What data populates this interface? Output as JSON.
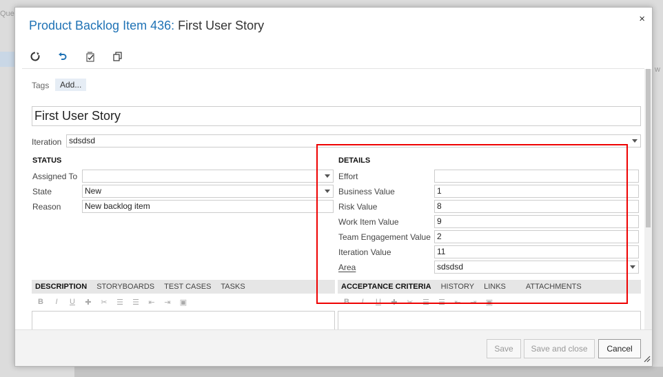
{
  "background": {
    "frag_top": "Queri",
    "frag_right": "w"
  },
  "dialog": {
    "title_link": "Product Backlog Item 436:",
    "title_text": " First User Story",
    "close": "×"
  },
  "toolbar": {
    "icons": [
      "refresh-icon",
      "undo-icon",
      "history-icon",
      "copy-icon"
    ]
  },
  "tags": {
    "label": "Tags",
    "add": "Add..."
  },
  "work_item_title": "First User Story",
  "iteration": {
    "label": "Iteration",
    "value": "sdsdsd"
  },
  "status": {
    "heading": "STATUS",
    "assigned_to": {
      "label": "Assigned To",
      "value": ""
    },
    "state": {
      "label": "State",
      "value": "New"
    },
    "reason": {
      "label": "Reason",
      "value": "New backlog item"
    }
  },
  "details": {
    "heading": "DETAILS",
    "effort": {
      "label": "Effort",
      "value": ""
    },
    "business_value": {
      "label": "Business Value",
      "value": "1"
    },
    "risk_value": {
      "label": "Risk Value",
      "value": "8"
    },
    "work_item_value": {
      "label": "Work Item Value",
      "value": "9"
    },
    "team_engagement_value": {
      "label": "Team Engagement Value",
      "value": "2"
    },
    "iteration_value": {
      "label": "Iteration Value",
      "value": "11"
    },
    "area": {
      "label": "Area",
      "value": "sdsdsd"
    }
  },
  "left_tabs": [
    "DESCRIPTION",
    "STORYBOARDS",
    "TEST CASES",
    "TASKS"
  ],
  "right_tabs": [
    "ACCEPTANCE CRITERIA",
    "HISTORY",
    "LINKS",
    "ATTACHMENTS"
  ],
  "rte": {
    "bold": "B",
    "italic": "I",
    "underline": "U"
  },
  "footer": {
    "save": "Save",
    "save_close": "Save and close",
    "cancel": "Cancel"
  },
  "colors": {
    "link": "#1f72b5",
    "highlight": "#e00000"
  }
}
